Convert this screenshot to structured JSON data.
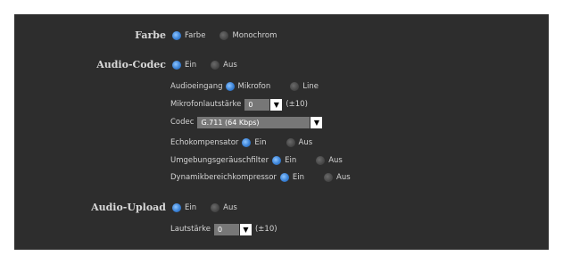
{
  "farbe": {
    "label": "Farbe",
    "options": [
      "Farbe",
      "Monochrom"
    ],
    "selected": 0
  },
  "audio_codec": {
    "label": "Audio-Codec",
    "options": [
      "Ein",
      "Aus"
    ],
    "audioeingang": {
      "label": "Audioeingang",
      "options": [
        "Mikrofon",
        "Line"
      ]
    },
    "mikrofonlautstaerke": {
      "label": "Mikrofonlautstärke",
      "value": "0",
      "range": "(±10)"
    },
    "codec": {
      "label": "Codec",
      "value": "G.711 (64 Kbps)"
    },
    "echokompensator": {
      "label": "Echokompensator",
      "options": [
        "Ein",
        "Aus"
      ]
    },
    "umgebungsgeraeuschfilter": {
      "label": "Umgebungsgeräuschfilter",
      "options": [
        "Ein",
        "Aus"
      ]
    },
    "dynamikbereichkompressor": {
      "label": "Dynamikbereichkompressor",
      "options": [
        "Ein",
        "Aus"
      ]
    }
  },
  "audio_upload": {
    "label": "Audio-Upload",
    "options": [
      "Ein",
      "Aus"
    ],
    "lautstaerke": {
      "label": "Lautstärke",
      "value": "0",
      "range": "(±10)"
    }
  },
  "icons": {
    "radio_on": "radio-selected-icon",
    "radio_off": "radio-unselected-icon",
    "dropdown": "triangle-down-icon"
  },
  "colors": {
    "panel_bg": "#2d2d2d",
    "radio_on": "#3b82d6",
    "text": "#d4d4d4"
  }
}
